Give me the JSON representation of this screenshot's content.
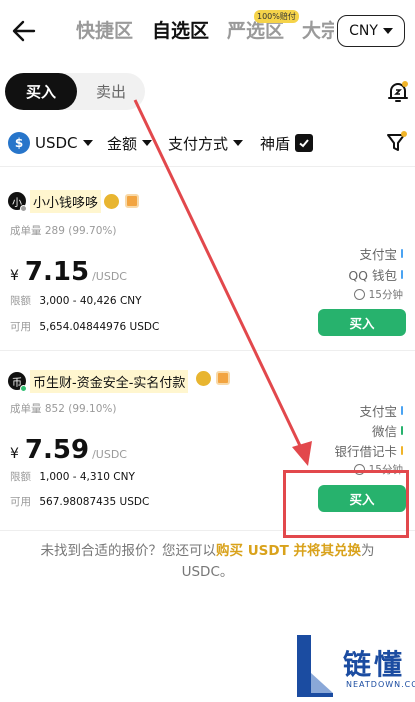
{
  "header": {
    "tabs": [
      {
        "label": "快捷区",
        "active": false
      },
      {
        "label": "自选区",
        "active": true
      },
      {
        "label": "严选区",
        "active": false,
        "badge": "100%赔付"
      },
      {
        "label": "大宗",
        "active": false
      }
    ],
    "currency": "CNY"
  },
  "toggle": {
    "buy": "买入",
    "sell": "卖出",
    "selected": "buy"
  },
  "filters": {
    "coin": "USDC",
    "coin_icon_text": "$",
    "amount": "金额",
    "payment": "支付方式",
    "shield": "神盾",
    "shield_checked": true
  },
  "merchants": [
    {
      "avatar_text": "小",
      "name": "小小钱哆哆",
      "orders_label": "成单量",
      "orders": "289 (99.70%)",
      "price_symbol": "¥",
      "price": "7.15",
      "price_unit": "/USDC",
      "limit_label": "限额",
      "limit": "3,000 - 40,426 CNY",
      "available_label": "可用",
      "available": "5,654.04844976 USDC",
      "payments": [
        {
          "label": "支付宝",
          "color": "#4aa3f2"
        },
        {
          "label": "QQ 钱包",
          "color": "#4aa3f2"
        }
      ],
      "time": "15分钟",
      "button": "买入"
    },
    {
      "avatar_text": "币",
      "name": "币生财-资金安全-实名付款",
      "orders_label": "成单量",
      "orders": "852 (99.10%)",
      "price_symbol": "¥",
      "price": "7.59",
      "price_unit": "/USDC",
      "limit_label": "限额",
      "limit": "1,000 - 4,310 CNY",
      "available_label": "可用",
      "available": "567.98087435 USDC",
      "payments": [
        {
          "label": "支付宝",
          "color": "#4aa3f2"
        },
        {
          "label": "微信",
          "color": "#27b26d"
        },
        {
          "label": "银行借记卡",
          "color": "#f0b429"
        }
      ],
      "time": "15分钟",
      "button": "买入"
    }
  ],
  "notice": {
    "part1": "未找到合适的报价？您还可以",
    "highlight": "购买 USDT 并将其兑换",
    "part2": "为 USDC。"
  },
  "watermark": {
    "text": "链懂",
    "sub": "NEATDOWN.COM"
  },
  "colors": {
    "accent_green": "#27b26d",
    "highlight_yellow": "#d9a21b",
    "annotation_red": "#e2484c"
  }
}
